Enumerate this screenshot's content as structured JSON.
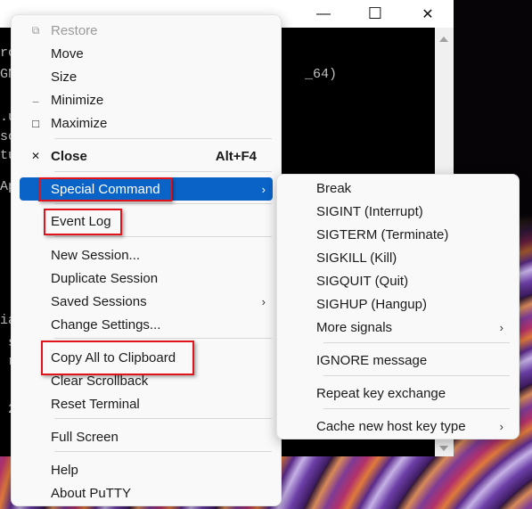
{
  "window": {
    "controls": {
      "minimize": "—",
      "maximize": "☐",
      "close": "✕"
    },
    "terminal_lines": [
      "rc",
      "GN                                    _64)",
      "",
      ".u",
      "sc",
      "tu",
      "",
      "Ap",
      "",
      "",
      "",
      "",
      "",
      "ia",
      " s",
      " r",
      "",
      " 2"
    ]
  },
  "main_menu": {
    "items": [
      {
        "label": "Restore",
        "icon": "restore-icon",
        "glyph": "⧉",
        "disabled": true
      },
      {
        "label": "Move"
      },
      {
        "label": "Size"
      },
      {
        "label": "Minimize",
        "icon": "minimize-icon",
        "glyph": "_"
      },
      {
        "label": "Maximize",
        "icon": "maximize-icon",
        "glyph": "□"
      },
      {
        "label": "Close",
        "icon": "close-icon",
        "glyph": "✕",
        "shortcut": "Alt+F4",
        "bold": true
      },
      {
        "label": "Special Command",
        "submenu": true,
        "selected": true,
        "highlighted": true
      },
      {
        "label": "Event Log",
        "highlighted": true
      },
      {
        "label": "New Session..."
      },
      {
        "label": "Duplicate Session"
      },
      {
        "label": "Saved Sessions",
        "submenu": true
      },
      {
        "label": "Change Settings..."
      },
      {
        "label": "Copy All to Clipboard",
        "highlighted": true
      },
      {
        "label": "Clear Scrollback"
      },
      {
        "label": "Reset Terminal"
      },
      {
        "label": "Full Screen"
      },
      {
        "label": "Help"
      },
      {
        "label": "About PuTTY"
      }
    ],
    "submenu_arrow": "›"
  },
  "special_command_menu": {
    "items": [
      {
        "label": "Break"
      },
      {
        "label": "SIGINT (Interrupt)"
      },
      {
        "label": "SIGTERM (Terminate)"
      },
      {
        "label": "SIGKILL (Kill)"
      },
      {
        "label": "SIGQUIT (Quit)"
      },
      {
        "label": "SIGHUP (Hangup)"
      },
      {
        "label": "More signals",
        "submenu": true
      },
      {
        "label": "IGNORE message"
      },
      {
        "label": "Repeat key exchange"
      },
      {
        "label": "Cache new host key type",
        "submenu": true
      }
    ]
  },
  "colors": {
    "selection": "#0a64c8",
    "highlight_box": "#e0141a",
    "menu_bg": "#f9f9f9"
  }
}
